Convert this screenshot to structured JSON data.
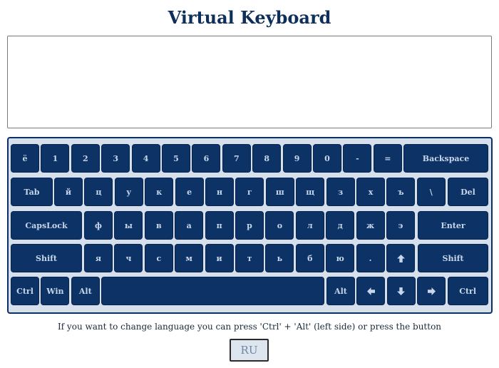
{
  "title": "Virtual Keyboard",
  "text_area": {
    "value": "",
    "placeholder": ""
  },
  "keyboard": {
    "row1": [
      "ё",
      "1",
      "2",
      "3",
      "4",
      "5",
      "6",
      "7",
      "8",
      "9",
      "0",
      "-",
      "=",
      "Backspace"
    ],
    "row2": [
      "Tab",
      "й",
      "ц",
      "у",
      "к",
      "е",
      "н",
      "г",
      "ш",
      "щ",
      "з",
      "х",
      "ъ",
      "\\",
      "Del"
    ],
    "row3": [
      "CapsLock",
      "ф",
      "ы",
      "в",
      "а",
      "п",
      "р",
      "о",
      "л",
      "д",
      "ж",
      "э",
      "Enter"
    ],
    "row4": [
      "Shift",
      "я",
      "ч",
      "с",
      "м",
      "и",
      "т",
      "ь",
      "б",
      "ю",
      ".",
      "",
      "Shift"
    ],
    "row5": [
      "Ctrl",
      "Win",
      "Alt",
      "",
      "Alt",
      "",
      "",
      "",
      "Ctrl"
    ],
    "icons": {
      "arrow_up": "arrow-up-icon",
      "arrow_left": "arrow-left-icon",
      "arrow_down": "arrow-down-icon",
      "arrow_right": "arrow-right-icon"
    },
    "colors": {
      "key_bg": "#0c3266",
      "key_text": "#c8d6ea",
      "board_bg": "#d6e0ec"
    }
  },
  "hint": "If you want to change language you can press 'Ctrl' + 'Alt' (left side) or press the button",
  "language_button": {
    "label": "RU"
  }
}
